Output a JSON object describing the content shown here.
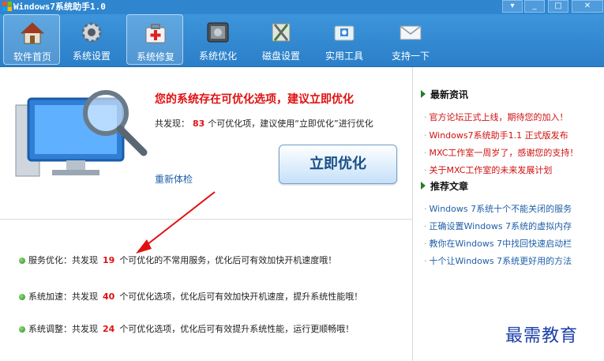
{
  "window": {
    "title": "Windows7系统助手1.0"
  },
  "toolbar": {
    "items": [
      {
        "label": "软件首页",
        "icon": "home-icon"
      },
      {
        "label": "系统设置",
        "icon": "gear-icon"
      },
      {
        "label": "系统修复",
        "icon": "medical-kit-icon"
      },
      {
        "label": "系统优化",
        "icon": "optimize-icon"
      },
      {
        "label": "磁盘设置",
        "icon": "disk-tools-icon"
      },
      {
        "label": "实用工具",
        "icon": "toolbox-icon"
      },
      {
        "label": "支持一下",
        "icon": "envelope-icon"
      }
    ],
    "selected": [
      "软件首页",
      "系统修复"
    ]
  },
  "main": {
    "headline": "您的系统存在可优化选项，建议立即优化",
    "found_prefix": "共发现：",
    "found_count": "83",
    "found_suffix": "个可优化项，建议使用“立即优化”进行优化",
    "optimize_button": "立即优化",
    "recheck_link": "重新体检",
    "rows": [
      {
        "prefix": "服务优化：共发现",
        "count": "19",
        "suffix": "个可优化的不常用服务，优化后可有效加快开机速度哦！"
      },
      {
        "prefix": "系统加速：共发现",
        "count": "40",
        "suffix": "个可优化选项，优化后可有效加快开机速度，提升系统性能哦！"
      },
      {
        "prefix": "系统调整：共发现",
        "count": "24",
        "suffix": "个可优化选项，优化后可有效提升系统性能，运行更顺畅哦！"
      }
    ]
  },
  "sidebar": {
    "news_title": "最新资讯",
    "news": [
      "官方论坛正式上线，期待您的加入！",
      "Windows7系统助手1.1 正式版发布",
      "MXC工作室一周岁了，感谢您的支持！",
      "关于MXC工作室的未来发展计划"
    ],
    "recommended_title": "推荐文章",
    "recommended": [
      "Windows 7系统十个不能关闭的服务",
      "正确设置Windows 7系统的虚拟内存",
      "教你在Windows 7中找回快速启动栏",
      "十个让Windows 7系统更好用的方法"
    ]
  },
  "watermark": "最需教育",
  "colors": {
    "titlebar": "#2f86cf",
    "alert_red": "#e01010",
    "link_blue": "#1f5fa8"
  }
}
